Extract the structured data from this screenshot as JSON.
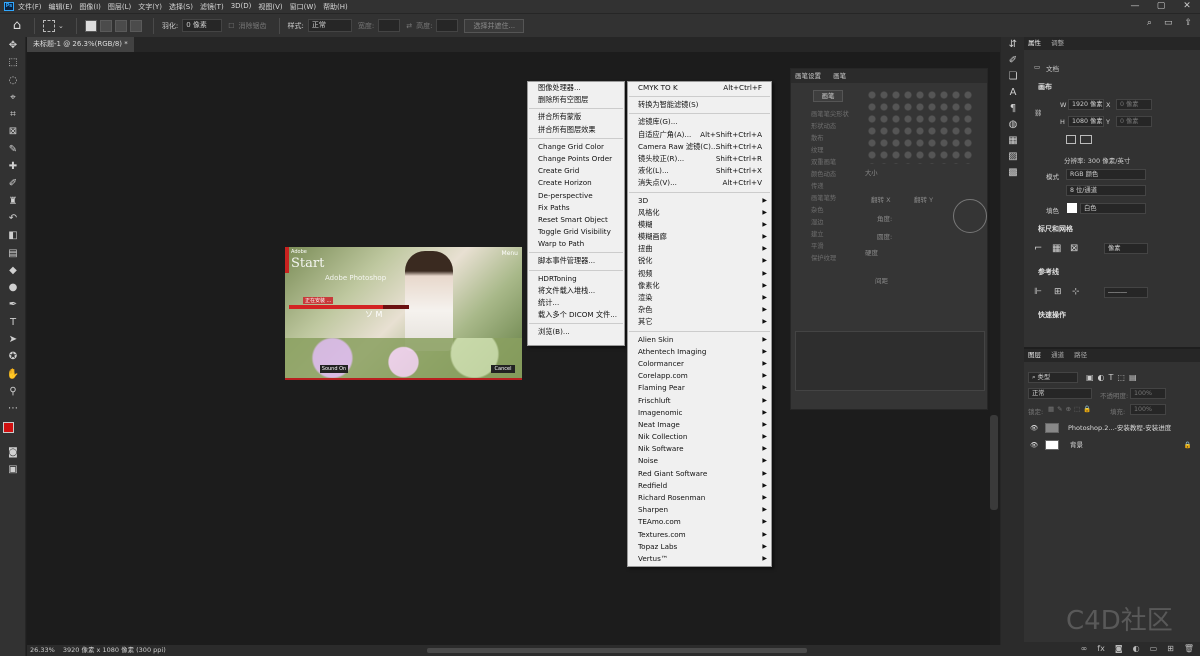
{
  "menubar": {
    "items": [
      "文件(F)",
      "编辑(E)",
      "图像(I)",
      "图层(L)",
      "文字(Y)",
      "选择(S)",
      "滤镜(T)",
      "3D(D)",
      "视图(V)",
      "窗口(W)",
      "帮助(H)"
    ],
    "window_controls": [
      "—",
      "▢",
      "✕"
    ]
  },
  "options_bar": {
    "feather_label": "羽化:",
    "feather_value": "0 像素",
    "antialias_label": "消除锯齿",
    "style_label": "样式:",
    "style_value": "正常",
    "width_label": "宽度:",
    "height_label": "高度:",
    "select_subject_button": "选择并遮住..."
  },
  "document": {
    "tab_title": "未标题-1 @ 26.3%(RGB/8) *",
    "status_zoom": "26.33%",
    "status_info": "3920 像素 x 1080 像素 (300 ppi)"
  },
  "doc_image": {
    "installer_small_title": "Adobe",
    "installer_big_title": "Start",
    "installer_subtitle": "Adobe Photoshop",
    "installer_menu": "Menu",
    "progress_label": "正在安装 ...",
    "progress_fraction": 0.78,
    "mid_text": "ソ M",
    "sound_button": "Sound On",
    "cancel_button": "Cancel"
  },
  "menu_scripts": [
    {
      "label": "图像处理器..."
    },
    {
      "label": "删除所有空图层"
    },
    {
      "sep": true
    },
    {
      "label": "拼合所有蒙版"
    },
    {
      "label": "拼合所有图层效果"
    },
    {
      "sep": true
    },
    {
      "label": "Change Grid Color"
    },
    {
      "label": "Change Points Order"
    },
    {
      "label": "Create Grid"
    },
    {
      "label": "Create Horizon"
    },
    {
      "label": "De-perspective"
    },
    {
      "label": "Fix Paths"
    },
    {
      "label": "Reset Smart Object"
    },
    {
      "label": "Toggle Grid Visibility"
    },
    {
      "label": "Warp to Path"
    },
    {
      "sep": true
    },
    {
      "label": "脚本事件管理器..."
    },
    {
      "sep": true
    },
    {
      "label": "HDRToning"
    },
    {
      "label": "将文件载入堆栈..."
    },
    {
      "label": "统计..."
    },
    {
      "label": "载入多个 DICOM 文件..."
    },
    {
      "sep": true
    },
    {
      "label": "浏览(B)..."
    }
  ],
  "menu_filters": [
    {
      "label": "CMYK TO K",
      "shortcut": "Alt+Ctrl+F"
    },
    {
      "sep": true
    },
    {
      "label": "转换为智能滤镜(S)"
    },
    {
      "sep": true
    },
    {
      "label": "滤镜库(G)..."
    },
    {
      "label": "自适应广角(A)...",
      "shortcut": "Alt+Shift+Ctrl+A"
    },
    {
      "label": "Camera Raw 滤镜(C)...",
      "shortcut": "Shift+Ctrl+A"
    },
    {
      "label": "镜头校正(R)...",
      "shortcut": "Shift+Ctrl+R"
    },
    {
      "label": "液化(L)...",
      "shortcut": "Shift+Ctrl+X"
    },
    {
      "label": "消失点(V)...",
      "shortcut": "Alt+Ctrl+V"
    },
    {
      "sep": true
    },
    {
      "label": "3D",
      "sub": true
    },
    {
      "label": "风格化",
      "sub": true
    },
    {
      "label": "模糊",
      "sub": true
    },
    {
      "label": "模糊画廊",
      "sub": true
    },
    {
      "label": "扭曲",
      "sub": true
    },
    {
      "label": "锐化",
      "sub": true
    },
    {
      "label": "视频",
      "sub": true
    },
    {
      "label": "像素化",
      "sub": true
    },
    {
      "label": "渲染",
      "sub": true
    },
    {
      "label": "杂色",
      "sub": true
    },
    {
      "label": "其它",
      "sub": true
    },
    {
      "sep": true
    },
    {
      "label": "Alien Skin",
      "sub": true
    },
    {
      "label": "Athentech Imaging",
      "sub": true
    },
    {
      "label": "Colormancer",
      "sub": true
    },
    {
      "label": "Corelapp.com",
      "sub": true
    },
    {
      "label": "Flaming Pear",
      "sub": true
    },
    {
      "label": "Frischluft",
      "sub": true
    },
    {
      "label": "Imagenomic",
      "sub": true
    },
    {
      "label": "Neat Image",
      "sub": true
    },
    {
      "label": "Nik Collection",
      "sub": true
    },
    {
      "label": "Nik Software",
      "sub": true
    },
    {
      "label": "Noise",
      "sub": true
    },
    {
      "label": "Red Giant Software",
      "sub": true
    },
    {
      "label": "Redfield",
      "sub": true
    },
    {
      "label": "Richard Rosenman",
      "sub": true
    },
    {
      "label": "Sharpen",
      "sub": true
    },
    {
      "label": "TEAmo.com",
      "sub": true
    },
    {
      "label": "Textures.com",
      "sub": true
    },
    {
      "label": "Topaz Labs",
      "sub": true
    },
    {
      "label": "Vertus™",
      "sub": true
    }
  ],
  "brush_panel": {
    "tabs": [
      "画笔设置",
      "画笔"
    ],
    "preset_button": "画笔",
    "options": [
      "画笔笔尖形状",
      "形状动态",
      "散布",
      "纹理",
      "双重画笔",
      "颜色动态",
      "传递",
      "画笔笔势",
      "杂色",
      "湿边",
      "建立",
      "平滑",
      "保护纹理"
    ],
    "size_label": "大小",
    "flip_x": "翻转 X",
    "flip_y": "翻转 Y",
    "angle_label": "角度:",
    "roundness_label": "圆度:",
    "hardness_label": "硬度",
    "spacing_label": "间距"
  },
  "properties": {
    "tabs": [
      "属性",
      "调整"
    ],
    "doc_label": "文档",
    "canvas_section": "画布",
    "w_label": "W",
    "w_value": "1920 像素",
    "h_label": "H",
    "h_value": "1080 像素",
    "x_label": "X",
    "x_placeholder": "0 像素",
    "y_label": "Y",
    "y_placeholder": "0 像素",
    "resolution": "分辨率: 300 像素/英寸",
    "mode_label": "模式",
    "mode_value": "RGB 颜色",
    "depth_value": "8 位/通道",
    "fill_label": "填色",
    "fill_value": "白色",
    "rulers_section": "标尺和网格",
    "units_value": "像素",
    "guides_section": "参考线",
    "quick_actions_section": "快速操作"
  },
  "layers": {
    "tabs": [
      "图层",
      "通道",
      "路径"
    ],
    "filter_value": "类型",
    "blend_value": "正常",
    "opacity_label": "不透明度:",
    "opacity_value": "100%",
    "lock_label": "锁定:",
    "fill_label": "填充:",
    "fill_value": "100%",
    "items": [
      {
        "name": "Photoshop.2...-安装教程-安装进度"
      },
      {
        "name": "背景"
      }
    ],
    "footer_icons": [
      "link-icon",
      "fx-icon",
      "mask-icon",
      "adjust-icon",
      "folder-icon",
      "new-layer-icon",
      "trash-icon"
    ]
  },
  "watermark": "C4D社区",
  "colors": {
    "accent_red": "#c8221f",
    "fg_swatch": "#d01010",
    "bg_swatch": "#ffffff"
  }
}
